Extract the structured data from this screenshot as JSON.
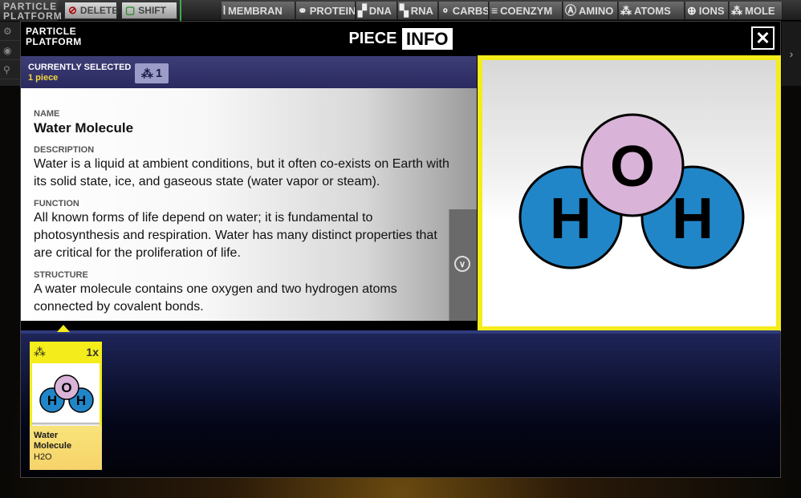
{
  "background": {
    "logo_line1": "PARTICLE",
    "logo_line2": "PLATFORM",
    "delete_label": "DELETE",
    "shift_label": "SHIFT",
    "categories": [
      {
        "label": "MEMBRAN",
        "icon": "membrane-icon"
      },
      {
        "label": "PROTEIN",
        "icon": "protein-icon"
      },
      {
        "label": "DNA",
        "icon": "dna-icon"
      },
      {
        "label": "RNA",
        "icon": "rna-icon"
      },
      {
        "label": "CARBS",
        "icon": "carbs-icon"
      },
      {
        "label": "COENZYM",
        "icon": "coenzyme-icon"
      },
      {
        "label": "AMINO",
        "icon": "amino-icon"
      },
      {
        "label": "ATOMS",
        "icon": "atoms-icon"
      },
      {
        "label": "IONS",
        "icon": "ions-icon"
      },
      {
        "label": "MOLE",
        "icon": "molecule-icon"
      }
    ]
  },
  "modal": {
    "logo_line1": "PARTICLE",
    "logo_line2": "PLATFORM",
    "title_piece": "PIECE",
    "title_info": "INFO",
    "close_symbol": "✕"
  },
  "selection": {
    "label": "CURRENTLY SELECTED",
    "count_text": "1 piece",
    "badge_count": "1"
  },
  "info": {
    "name_label": "NAME",
    "name": "Water Molecule",
    "description_label": "DESCRIPTION",
    "description": "Water is a liquid at ambient conditions, but it often co-exists on Earth with its solid state, ice, and gaseous state (water vapor or steam).",
    "function_label": "FUNCTION",
    "function": "All known forms of life depend on water; it is fundamental to photosynthesis and respiration. Water has many distinct properties that are critical for the proliferation of life.",
    "structure_label": "STRUCTURE",
    "structure": "A water molecule contains one oxygen and two hydrogen atoms connected by covalent bonds."
  },
  "molecule": {
    "oxygen_label": "O",
    "hydrogen_label": "H",
    "oxygen_color": "#d9b3d8",
    "hydrogen_color": "#2186c8",
    "outline_color": "#000000"
  },
  "tray": {
    "qty": "1x",
    "card_name_line1": "Water",
    "card_name_line2": "Molecule",
    "card_formula": "H2O"
  },
  "colors": {
    "accent_yellow": "#f4ec1b",
    "selection_bar": "#2f2f68",
    "selected_count": "#f2d53c"
  }
}
